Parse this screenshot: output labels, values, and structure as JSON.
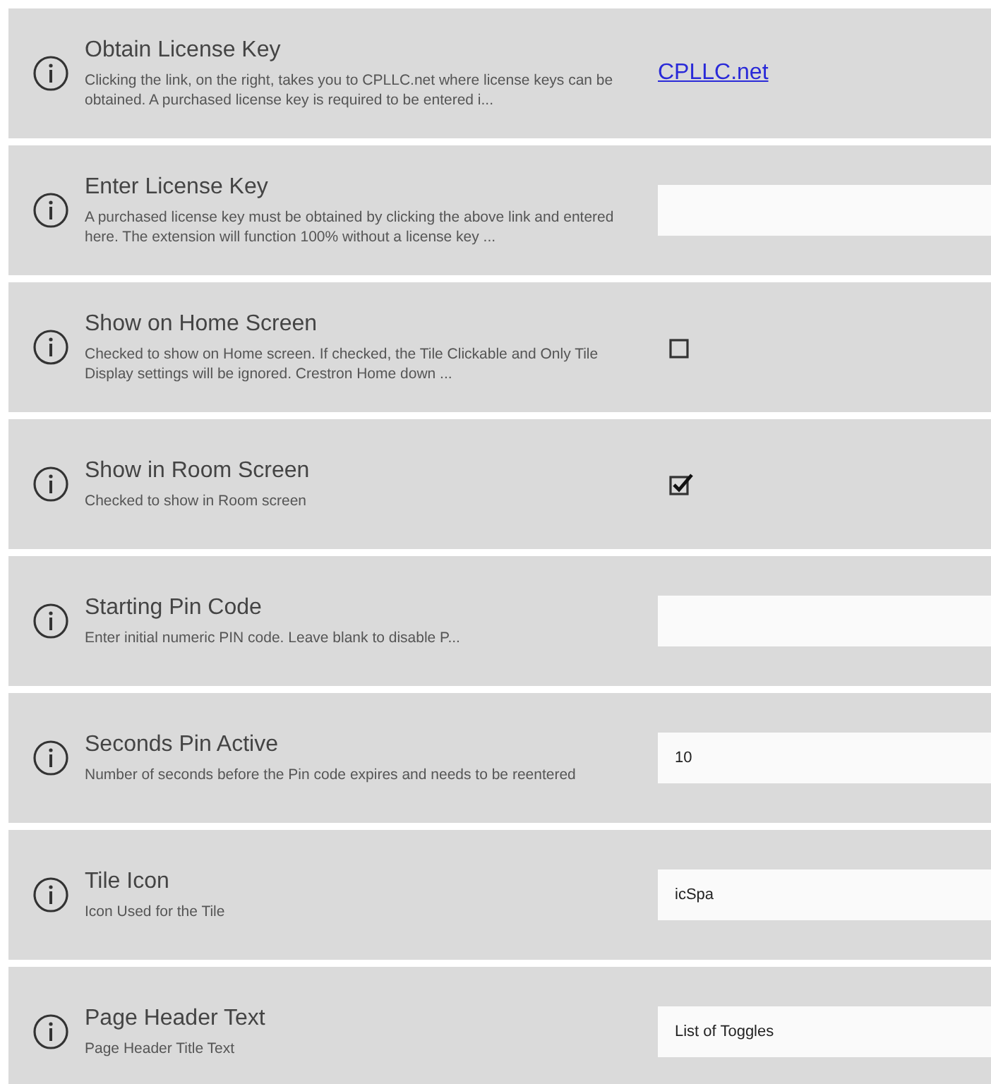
{
  "settings": [
    {
      "title": "Obtain License Key",
      "description": "Clicking the link, on the right, takes you to CPLLC.net where license keys can be obtained.  A purchased license key is required to be entered i...",
      "kind": "link",
      "link": "CPLLC.net"
    },
    {
      "title": "Enter License Key",
      "description": "A purchased license key must be obtained by clicking the above link and entered here. The extension will function 100% without a license key ...",
      "kind": "text"
    },
    {
      "title": "Show on Home Screen",
      "description": "Checked to show on Home screen.  If checked, the Tile Clickable and Only Tile Display settings will be ignored.  Crestron Home down ...",
      "kind": "checkbox",
      "checked": false
    },
    {
      "title": "Show in Room Screen",
      "description": "Checked to show in Room screen",
      "kind": "checkbox",
      "checked": true
    },
    {
      "title": "Starting Pin Code",
      "description": "Enter initial numeric PIN code.  Leave blank to disable P...",
      "kind": "text"
    },
    {
      "title": "Seconds Pin Active",
      "description": "Number of seconds before the Pin code expires and needs to be reentered",
      "kind": "text",
      "value": "10"
    },
    {
      "title": "Tile Icon",
      "description": "Icon Used for the Tile",
      "kind": "text",
      "value": "icSpa"
    },
    {
      "title": "Page Header Text",
      "description": "Page Header Title Text",
      "kind": "text",
      "value": "List of Toggles"
    }
  ]
}
